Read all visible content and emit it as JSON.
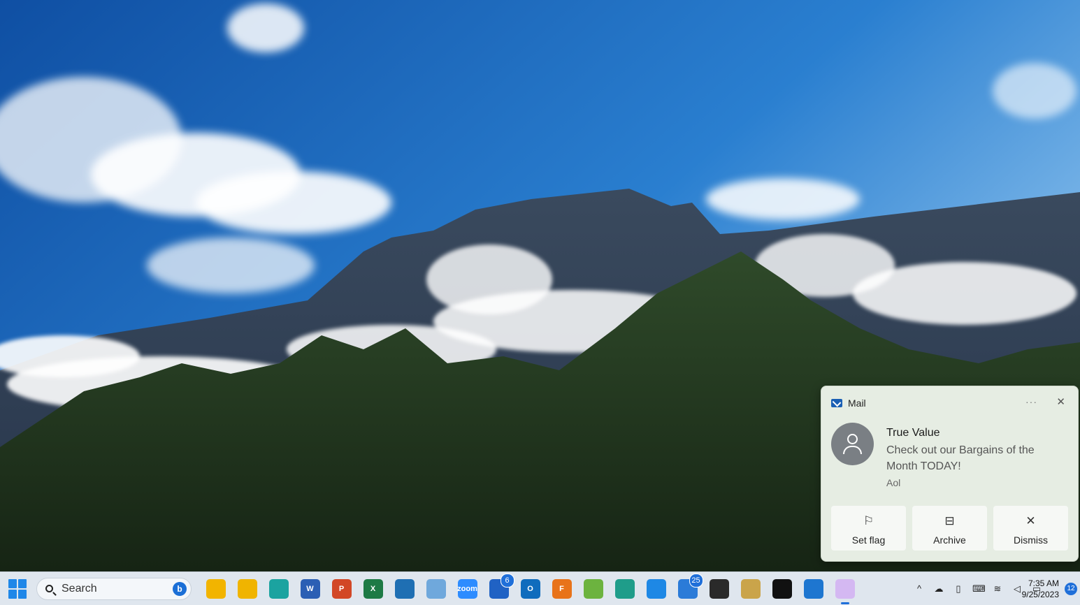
{
  "taskbar": {
    "search_placeholder": "Search",
    "apps": [
      {
        "name": "widgets",
        "label": "",
        "color": "#f2b400"
      },
      {
        "name": "file-explorer",
        "label": "",
        "color": "#f0b400"
      },
      {
        "name": "edge",
        "label": "",
        "color": "#1ba3a0"
      },
      {
        "name": "word",
        "label": "W",
        "color": "#2b5fb4"
      },
      {
        "name": "powerpoint",
        "label": "P",
        "color": "#d24726"
      },
      {
        "name": "excel",
        "label": "X",
        "color": "#1d7a45"
      },
      {
        "name": "camera",
        "label": "",
        "color": "#1f6fb3"
      },
      {
        "name": "photos",
        "label": "",
        "color": "#6fa8dc"
      },
      {
        "name": "zoom",
        "label": "zoom",
        "color": "#2d8cff"
      },
      {
        "name": "mail",
        "label": "",
        "color": "#2062c4",
        "badge": "6"
      },
      {
        "name": "outlook",
        "label": "O",
        "color": "#0f6cbd"
      },
      {
        "name": "flux",
        "label": "F",
        "color": "#e8731a"
      },
      {
        "name": "stacks",
        "label": "",
        "color": "#6cb33f"
      },
      {
        "name": "edge-dev",
        "label": "",
        "color": "#1f9d8a"
      },
      {
        "name": "vscode",
        "label": "",
        "color": "#1e88e5"
      },
      {
        "name": "teams",
        "label": "",
        "color": "#2b7bd8",
        "badge": "25"
      },
      {
        "name": "affinity",
        "label": "",
        "color": "#2a2a2a"
      },
      {
        "name": "app-bag",
        "label": "",
        "color": "#caa44a"
      },
      {
        "name": "notion",
        "label": "",
        "color": "#111111"
      },
      {
        "name": "outlook-new",
        "label": "",
        "color": "#1e76d0"
      },
      {
        "name": "snipping-tool",
        "label": "",
        "color": "#d4b8f2"
      }
    ],
    "tray_icons": [
      "chevron-up",
      "cloud",
      "usb",
      "keyboard",
      "wifi",
      "volume",
      "battery"
    ],
    "time": "7:35 AM",
    "date": "9/25/2023",
    "notification_count": "12"
  },
  "toast": {
    "app_name": "Mail",
    "more_label": "···",
    "close_label": "✕",
    "sender": "True Value",
    "message": "Check out our Bargains of the Month TODAY!",
    "account": "Aol",
    "actions": [
      {
        "label": "Set flag",
        "icon": "⚐"
      },
      {
        "label": "Archive",
        "icon": "⊟"
      },
      {
        "label": "Dismiss",
        "icon": "✕"
      }
    ]
  }
}
